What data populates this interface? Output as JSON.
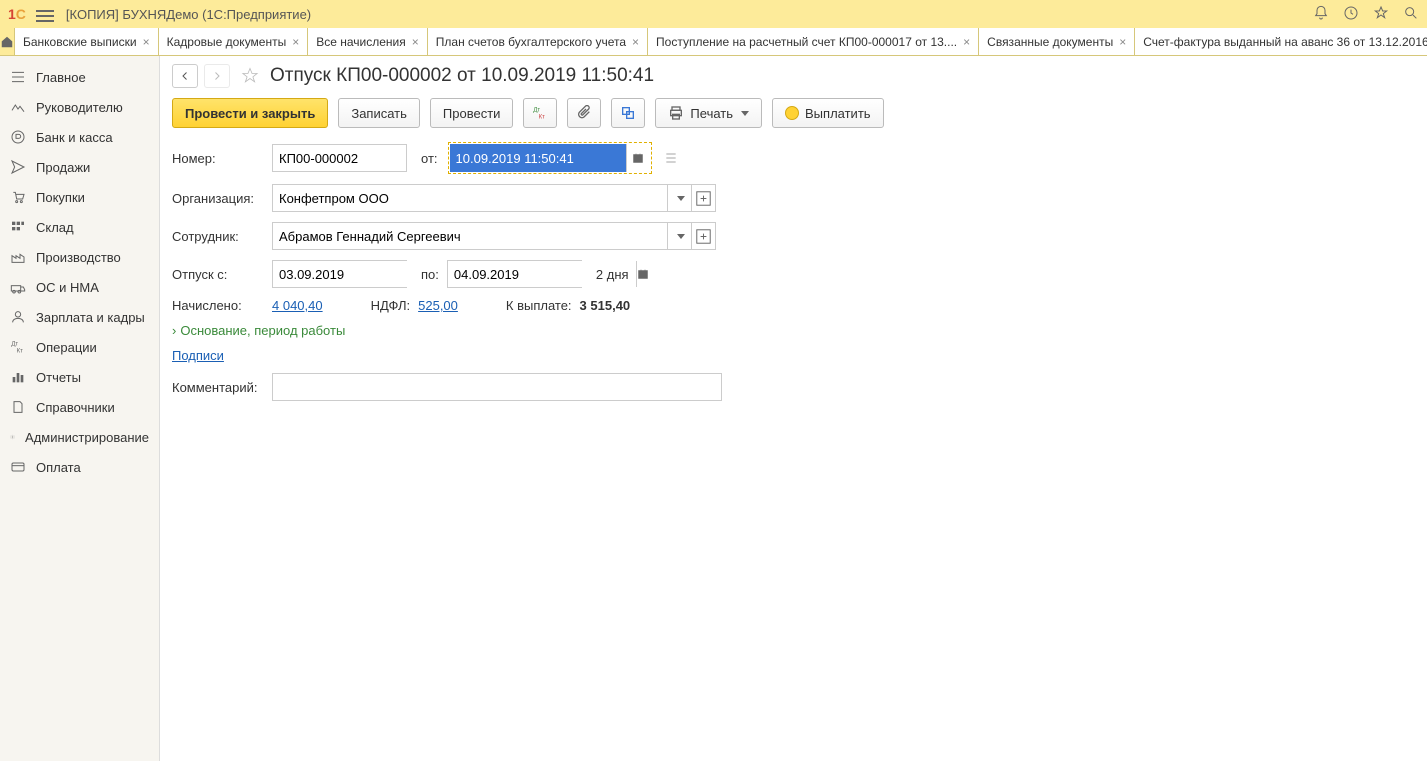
{
  "app_title": "[КОПИЯ] БУХНЯДемо  (1С:Предприятие)",
  "tabs": [
    "Банковские выписки",
    "Кадровые документы",
    "Все начисления",
    "План счетов бухгалтерского учета",
    "Поступление на расчетный счет КП00-000017 от 13....",
    "Связанные документы",
    "Счет-фактура выданный на аванс 36 от 13.12.2016"
  ],
  "sidebar": {
    "items": [
      "Главное",
      "Руководителю",
      "Банк и касса",
      "Продажи",
      "Покупки",
      "Склад",
      "Производство",
      "ОС и НМА",
      "Зарплата и кадры",
      "Операции",
      "Отчеты",
      "Справочники",
      "Администрирование",
      "Оплата"
    ]
  },
  "page_title": "Отпуск КП00-000002 от 10.09.2019 11:50:41",
  "toolbar": {
    "post_close": "Провести и закрыть",
    "save": "Записать",
    "post": "Провести",
    "print": "Печать",
    "pay": "Выплатить"
  },
  "form": {
    "number_label": "Номер:",
    "number_value": "КП00-000002",
    "date_label": "от:",
    "date_value": "10.09.2019 11:50:41",
    "org_label": "Организация:",
    "org_value": "Конфетпром ООО",
    "employee_label": "Сотрудник:",
    "employee_value": "Абрамов Геннадий Сергеевич",
    "vacation_from_label": "Отпуск с:",
    "vacation_from": "03.09.2019",
    "vacation_to_label": "по:",
    "vacation_to": "04.09.2019",
    "days": "2 дня",
    "accrued_label": "Начислено:",
    "accrued_value": "4 040,40",
    "ndfl_label": "НДФЛ:",
    "ndfl_value": "525,00",
    "to_pay_label": "К выплате:",
    "to_pay_value": "3 515,40",
    "basis_link": "Основание, период работы",
    "signatures_link": "Подписи",
    "comment_label": "Комментарий:"
  }
}
